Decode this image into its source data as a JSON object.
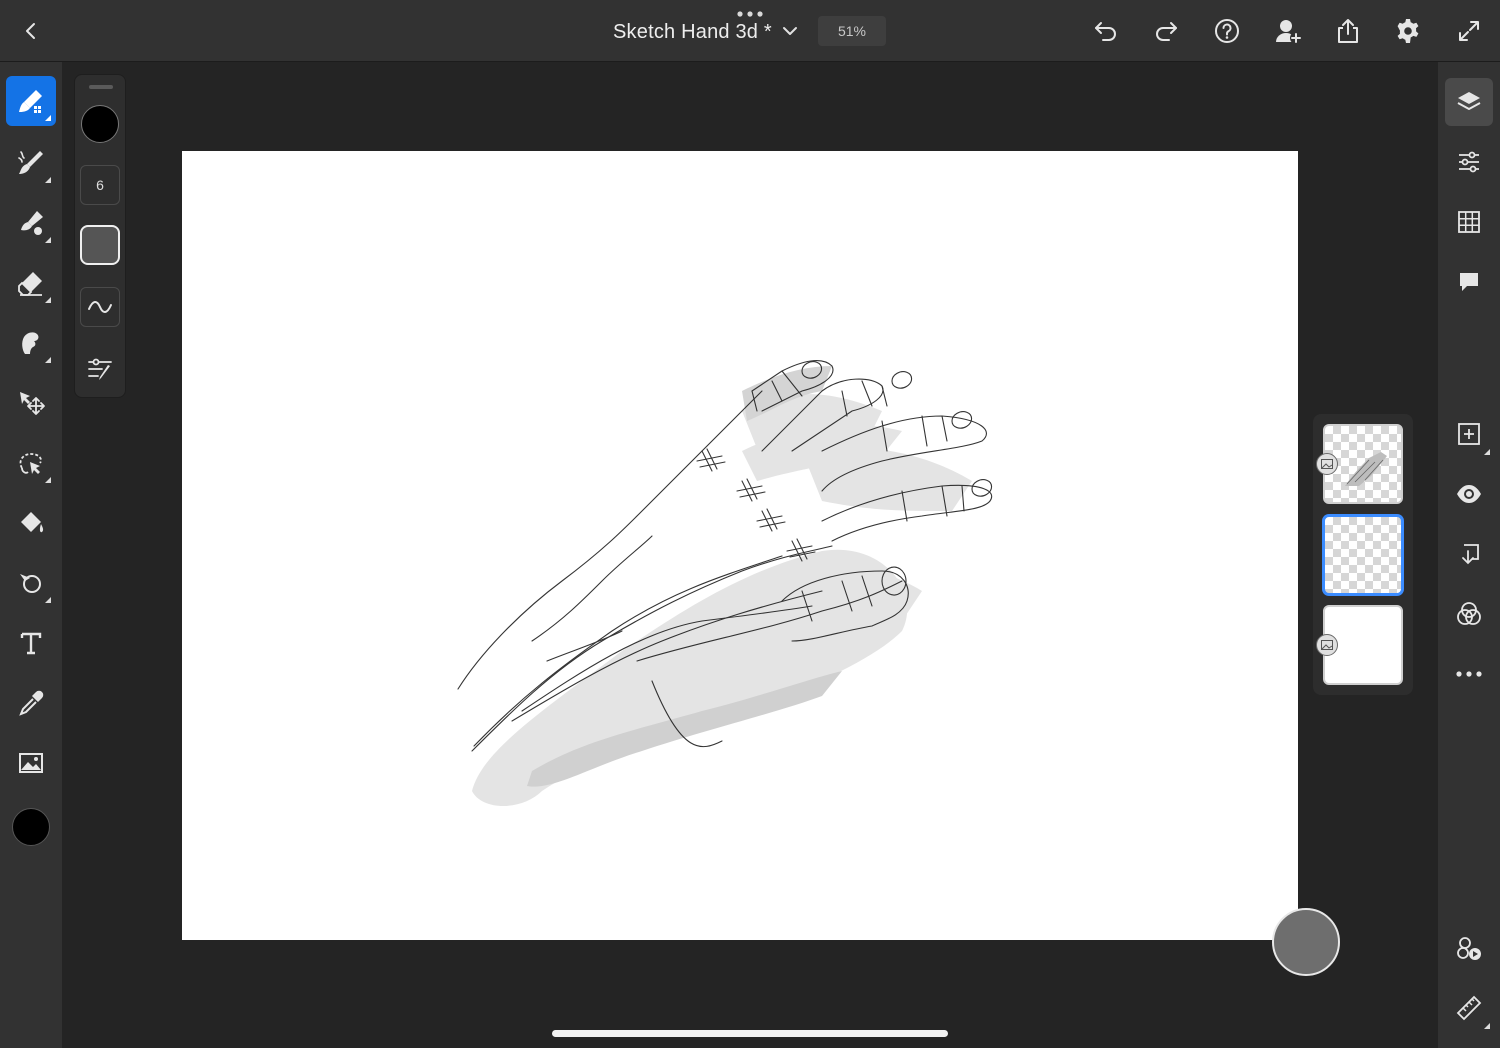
{
  "topbar": {
    "title": "Sketch Hand 3d *",
    "zoom": "51%",
    "icons": [
      "chevron-left-icon",
      "more-dots-icon",
      "chevron-down-icon",
      "undo-icon",
      "redo-icon",
      "help-icon",
      "invite-icon",
      "share-icon",
      "settings-icon",
      "fullscreen-icon"
    ]
  },
  "left_toolbar": {
    "tools": [
      "pixel-brush",
      "live-brush",
      "mixer-brush",
      "eraser",
      "smudge",
      "move-transform",
      "lasso-selection",
      "fill",
      "shape",
      "text",
      "eyedropper",
      "place-image"
    ],
    "active_tool": "pixel-brush",
    "color": "#000000"
  },
  "tool_options": {
    "brush_color": "#000000",
    "brush_size": "6",
    "opacity_swatch": "#555555"
  },
  "layers": {
    "items": [
      {
        "name": "sketch-layer",
        "type": "pixel",
        "selected": false,
        "thumbnail": "hand-sketch"
      },
      {
        "name": "empty-layer",
        "type": "pixel",
        "selected": true,
        "thumbnail": "transparent"
      },
      {
        "name": "background-layer",
        "type": "pixel",
        "selected": false,
        "thumbnail": "white"
      }
    ]
  },
  "right_toolbar": {
    "tools": [
      "layers",
      "adjustments",
      "grid",
      "comments",
      "add-layer",
      "visibility",
      "merge-down",
      "blend-modes",
      "more",
      "remix",
      "ruler"
    ],
    "active_tool": "layers"
  },
  "colors": {
    "accent": "#1473e6",
    "selected_layer": "#3b8cff",
    "app_bg": "#242424",
    "panel_bg": "#323232"
  }
}
